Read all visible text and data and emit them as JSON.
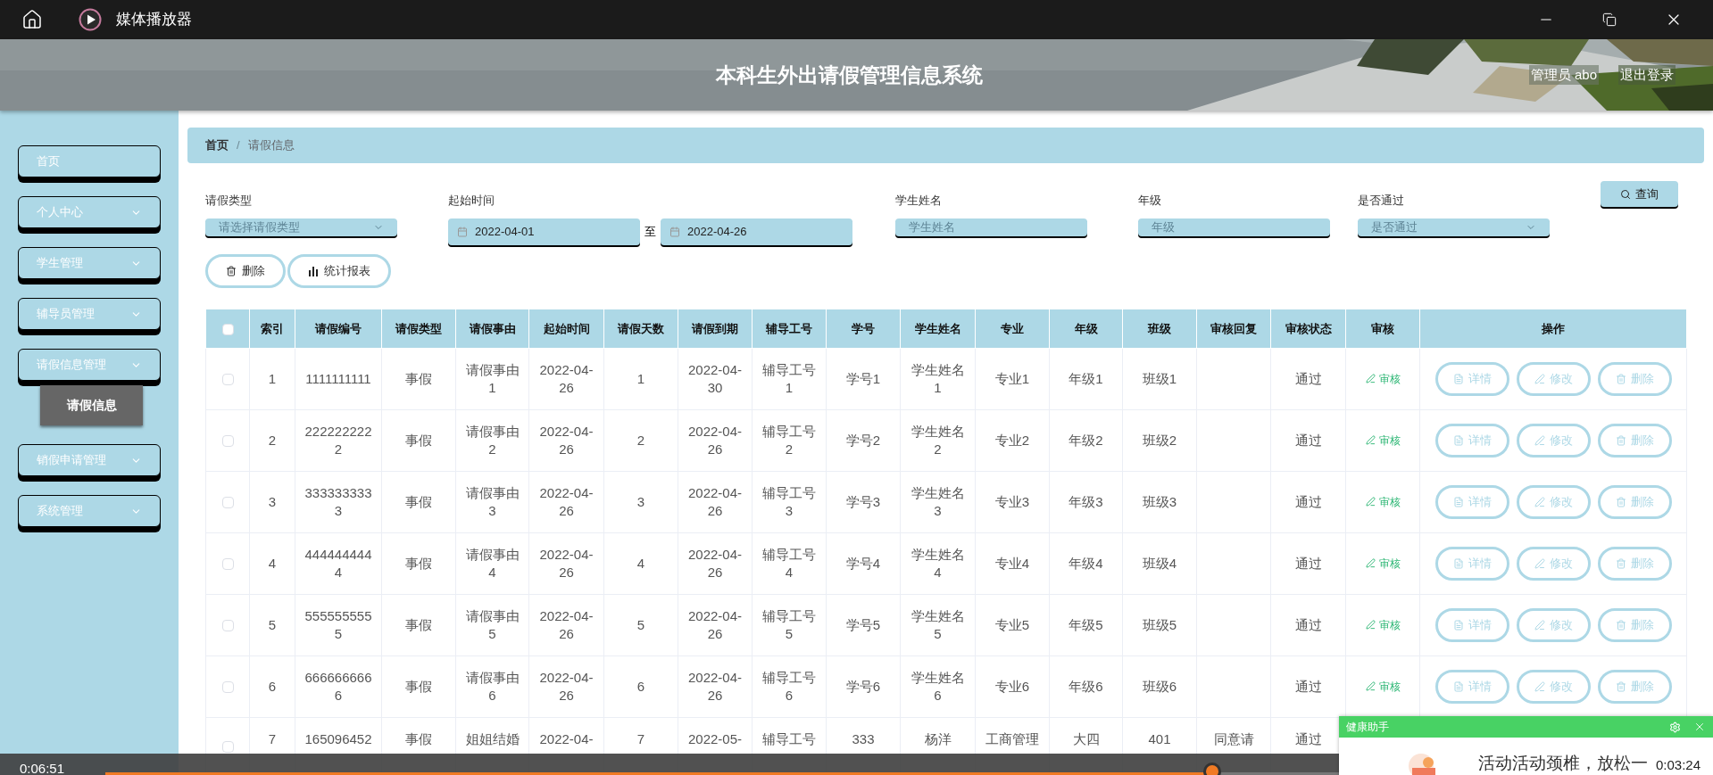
{
  "titlebar": {
    "title": "媒体播放器"
  },
  "header": {
    "title": "本科生外出请假管理信息系统",
    "user": "管理员 abo",
    "logout": "退出登录"
  },
  "sidebar": {
    "items": [
      {
        "label": "首页",
        "kind": "link"
      },
      {
        "label": "个人中心",
        "kind": "menu"
      },
      {
        "label": "学生管理",
        "kind": "menu"
      },
      {
        "label": "辅导员管理",
        "kind": "menu"
      },
      {
        "label": "请假信息管理",
        "kind": "menu",
        "children": [
          {
            "label": "请假信息",
            "selected": true
          }
        ]
      },
      {
        "label": "销假申请管理",
        "kind": "menu"
      },
      {
        "label": "系统管理",
        "kind": "menu"
      }
    ]
  },
  "breadcrumb": [
    "首页",
    "请假信息"
  ],
  "breadcrumb_separator": "/",
  "filters": [
    {
      "label": "请假类型",
      "kind": "select",
      "placeholder": "请选择请假类型"
    },
    {
      "label": "起始时间",
      "kind": "daterange",
      "from": "2022-04-01",
      "separator": "至",
      "to": "2022-04-26"
    },
    {
      "label": "学生姓名",
      "kind": "text",
      "placeholder": "学生姓名"
    },
    {
      "label": "年级",
      "kind": "text",
      "placeholder": "年级"
    },
    {
      "label": "是否通过",
      "kind": "select",
      "placeholder": "是否通过"
    }
  ],
  "search_button": "查询",
  "actions": [
    {
      "label": "删除",
      "kind": "delete"
    },
    {
      "label": "统计报表",
      "kind": "report"
    }
  ],
  "table": {
    "columns": [
      "索引",
      "请假编号",
      "请假类型",
      "请假事由",
      "起始时间",
      "请假天数",
      "请假到期",
      "辅导工号",
      "学号",
      "学生姓名",
      "专业",
      "年级",
      "班级",
      "审核回复",
      "审核状态",
      "审核",
      "操作"
    ],
    "all_checked": false,
    "rows": [
      {
        "kind": "full",
        "checked": false,
        "index": "1",
        "number": "1111111111",
        "type": "事假",
        "reason": "请假事由1",
        "start": "2022-04-26",
        "days": "1",
        "end": "2022-04-30",
        "teacher": "辅导工号1",
        "sid": "学号1",
        "name": "学生姓名1",
        "major": "专业1",
        "grade": "年级1",
        "class": "班级1",
        "status": "通过",
        "review": "审核",
        "ops": [
          "详情",
          "修改",
          "删除"
        ]
      },
      {
        "kind": "full",
        "checked": false,
        "index": "2",
        "number": "2222222222",
        "type": "事假",
        "reason": "请假事由2",
        "start": "2022-04-26",
        "days": "2",
        "end": "2022-04-26",
        "teacher": "辅导工号2",
        "sid": "学号2",
        "name": "学生姓名2",
        "major": "专业2",
        "grade": "年级2",
        "class": "班级2",
        "status": "通过",
        "review": "审核",
        "ops": [
          "详情",
          "修改",
          "删除"
        ]
      },
      {
        "kind": "full",
        "checked": false,
        "index": "3",
        "number": "3333333333",
        "type": "事假",
        "reason": "请假事由3",
        "start": "2022-04-26",
        "days": "3",
        "end": "2022-04-26",
        "teacher": "辅导工号3",
        "sid": "学号3",
        "name": "学生姓名3",
        "major": "专业3",
        "grade": "年级3",
        "class": "班级3",
        "status": "通过",
        "review": "审核",
        "ops": [
          "详情",
          "修改",
          "删除"
        ]
      },
      {
        "kind": "full",
        "checked": false,
        "index": "4",
        "number": "4444444444",
        "type": "事假",
        "reason": "请假事由4",
        "start": "2022-04-26",
        "days": "4",
        "end": "2022-04-26",
        "teacher": "辅导工号4",
        "sid": "学号4",
        "name": "学生姓名4",
        "major": "专业4",
        "grade": "年级4",
        "class": "班级4",
        "status": "通过",
        "review": "审核",
        "ops": [
          "详情",
          "修改",
          "删除"
        ]
      },
      {
        "kind": "full",
        "checked": false,
        "index": "5",
        "number": "5555555555",
        "type": "事假",
        "reason": "请假事由5",
        "start": "2022-04-26",
        "days": "5",
        "end": "2022-04-26",
        "teacher": "辅导工号5",
        "sid": "学号5",
        "name": "学生姓名5",
        "major": "专业5",
        "grade": "年级5",
        "class": "班级5",
        "status": "通过",
        "review": "审核",
        "ops": [
          "详情",
          "修改",
          "删除"
        ]
      },
      {
        "kind": "full",
        "checked": false,
        "index": "6",
        "number": "6666666666",
        "type": "事假",
        "reason": "请假事由6",
        "start": "2022-04-26",
        "days": "6",
        "end": "2022-04-26",
        "teacher": "辅导工号6",
        "sid": "学号6",
        "name": "学生姓名6",
        "major": "专业6",
        "grade": "年级6",
        "class": "班级6",
        "status": "通过",
        "review": "审核",
        "ops": [
          "详情",
          "修改",
          "删除"
        ]
      },
      {
        "kind": "partial",
        "checked": false,
        "index": "7",
        "number": "165096452",
        "type": "事假",
        "reason": "姐姐结婚",
        "start": "2022-04-",
        "days": "7",
        "end": "2022-05-",
        "teacher": "辅导工号",
        "sid": "333",
        "name": "杨洋",
        "major": "工商管理",
        "grade": "大四",
        "class": "401",
        "reply": "同意请",
        "status": "通过"
      }
    ]
  },
  "popup": {
    "title": "健康助手",
    "message": "活动活动颈椎，放松一"
  },
  "player": {
    "elapsed": "0:06:51",
    "remaining": "0:03:24",
    "level": 0.72
  }
}
